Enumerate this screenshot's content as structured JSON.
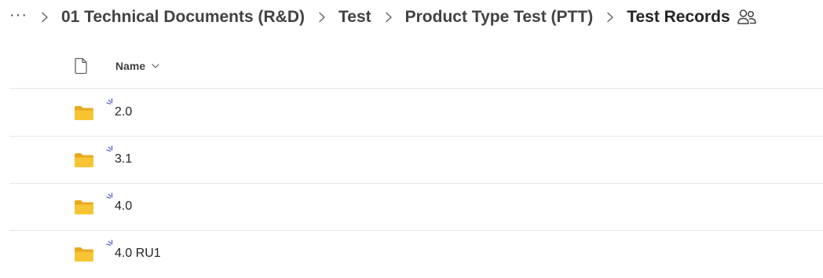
{
  "breadcrumb": {
    "more": "···",
    "items": [
      {
        "label": "01 Technical Documents (R&D)"
      },
      {
        "label": "Test"
      },
      {
        "label": "Product Type Test (PTT)"
      },
      {
        "label": "Test Records"
      }
    ],
    "current_icon": "people-icon"
  },
  "list": {
    "header_icon": "document-icon",
    "name_column": "Name",
    "sort_icon": "chevron-down-icon",
    "rows": [
      {
        "name": "2.0",
        "icon": "folder-icon",
        "status_icon": "new-item-sparkle-icon"
      },
      {
        "name": "3.1",
        "icon": "folder-icon",
        "status_icon": "new-item-sparkle-icon"
      },
      {
        "name": "4.0",
        "icon": "folder-icon",
        "status_icon": "new-item-sparkle-icon"
      },
      {
        "name": "4.0 RU1",
        "icon": "folder-icon",
        "status_icon": "new-item-sparkle-icon"
      }
    ]
  },
  "colors": {
    "folder": "#f4c12f",
    "folder_back": "#e9a91f",
    "sparkle": "#5b5fc7",
    "divider": "#e6e6e6"
  }
}
